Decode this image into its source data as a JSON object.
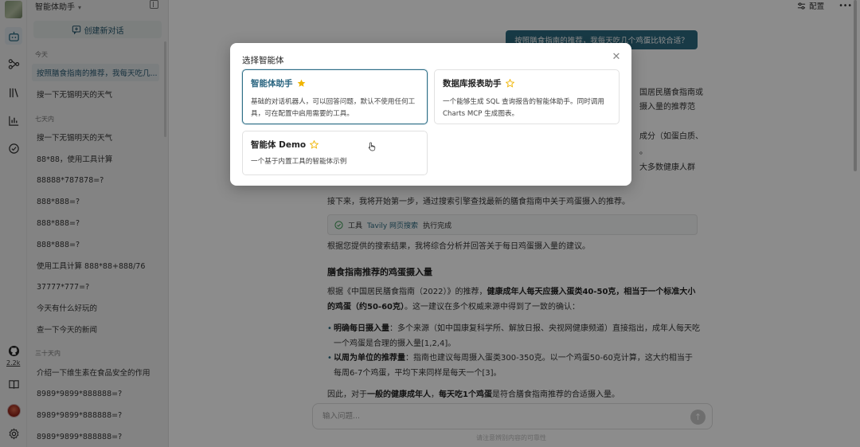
{
  "rail": {
    "github_count": "2.2k"
  },
  "sidebar": {
    "title": "智能体助手",
    "new_chat_label": "创建新对话",
    "sections": [
      {
        "label": "今天",
        "items": [
          "按照膳食指南的推荐，我每天吃几...",
          "搜一下无锡明天的天气"
        ]
      },
      {
        "label": "七天内",
        "items": [
          "搜一下无锡明天的天气",
          "88*88，使用工具计算",
          "88888*787878=?",
          "888*888=?",
          "888*888=?",
          "888*888=?",
          "使用工具计算 888*88+888/76",
          "37777*777=?",
          "今天有什么好玩的",
          "查一下今天的新闻"
        ]
      },
      {
        "label": "三十天内",
        "items": [
          "介绍一下维生素在食品安全的作用",
          "8989*9899*888888=?",
          "8989*9899*888888=?",
          "8989*9899*888888=?"
        ]
      }
    ]
  },
  "main": {
    "config_label": "配置",
    "user_message": "按照膳食指南的推荐，我每天吃几个鸡蛋比较合适？",
    "partial_lines": [
      "国居民膳食指南或",
      "摄入量的推荐范",
      "成分（如蛋白质、",
      "。",
      "大多数健康人群"
    ],
    "step_text": "接下来，我将开始第一步，通过搜索引擎查找最新的膳食指南中关于鸡蛋摄入的推荐。",
    "tool": {
      "prefix": "工具",
      "name": "Tavily 网页搜索",
      "status": "执行完成"
    },
    "analysis_text": "根据您提供的搜索结果，我将综合分析并回答关于每日鸡蛋摄入量的建议。",
    "heading": "膳食指南推荐的鸡蛋摄入量",
    "para1_pre": "根据《中国居民膳食指南（2022）》的推荐，",
    "para1_bold": "健康成年人每天应摄入蛋类40-50克，相当于一个标准大小的鸡蛋（约50-60克）",
    "para1_post": "。这一建议在多个权威来源中得到了一致的确认：",
    "bullets": [
      {
        "bold": "明确每日摄入量",
        "text": "：多个来源（如中国康复科学所、解放日报、央视网健康频道）直接指出，成年人每天吃一个鸡蛋是合理的摄入量[1,2,4]。"
      },
      {
        "bold": "以周为单位的推荐量",
        "text": "：指南也建议每周摄入蛋类300-350克。以一个鸡蛋50-60克计算，这大约相当于每周6-7个鸡蛋，平均下来同样是每天一个[3]。"
      }
    ],
    "conclusion_pre": "因此，对于",
    "conclusion_bold1": "一般的健康成年人",
    "conclusion_mid": "，",
    "conclusion_bold2": "每天吃1个鸡蛋",
    "conclusion_post": "是符合膳食指南推荐的合适摄入量。",
    "input_placeholder": "输入问题...",
    "footnote": "请注意辨别内容的可靠性"
  },
  "modal": {
    "title": "选择智能体",
    "agents": [
      {
        "name": "智能体助手",
        "starred": true,
        "description": "基础的对话机器人，可以回答问题，默认不使用任何工具，可在配置中启用需要的工具。"
      },
      {
        "name": "数据库报表助手",
        "starred": false,
        "description": "一个能够生成 SQL 查询报告的智能体助手。同时调用 Charts MCP 生成图表。"
      },
      {
        "name": "智能体 Demo",
        "starred": false,
        "description": "一个基于内置工具的智能体示例"
      }
    ]
  },
  "colors": {
    "accent": "#2c6a80",
    "star_filled": "#f0b400",
    "star_outline": "#f0b400"
  }
}
